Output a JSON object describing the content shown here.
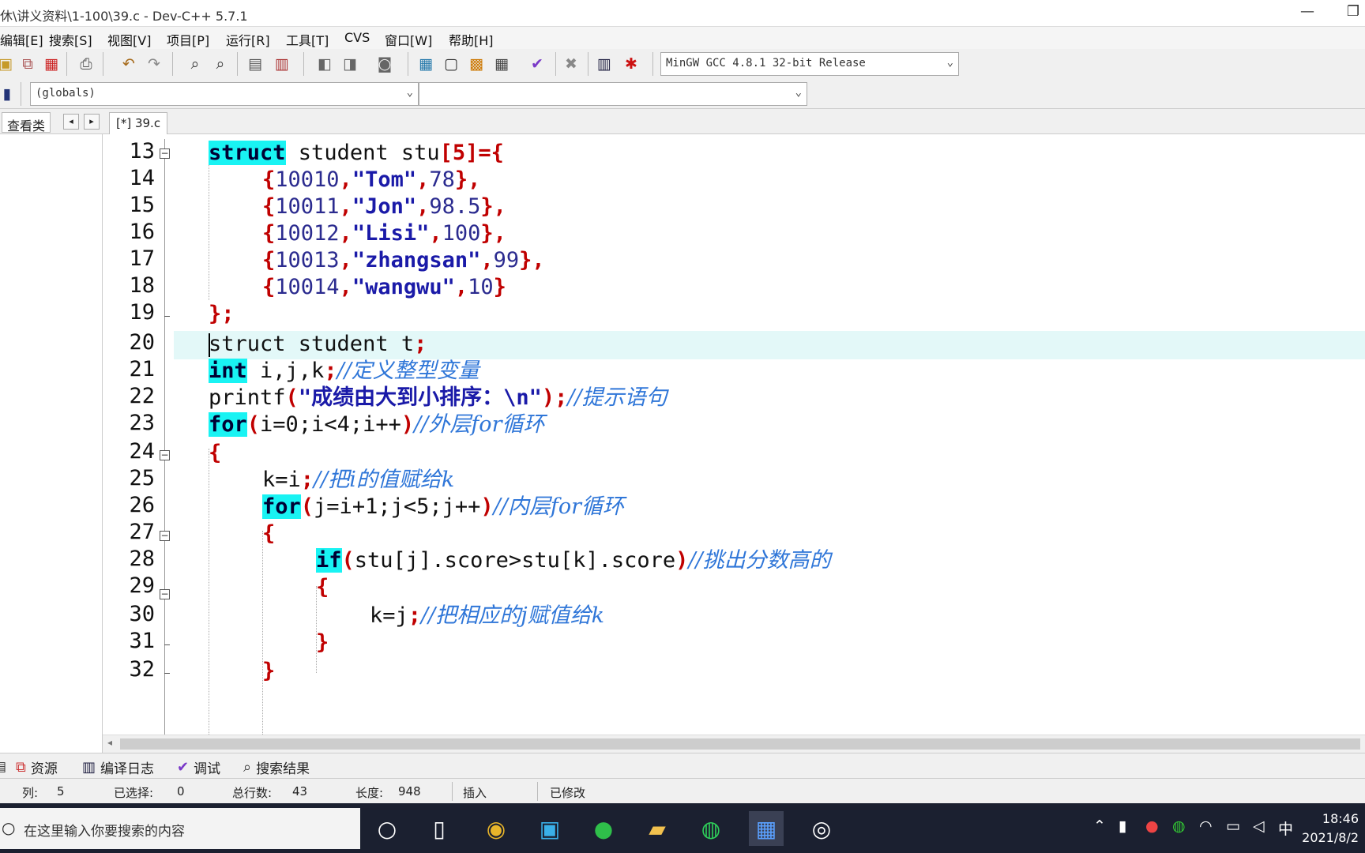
{
  "window": {
    "title": "休\\讲义资料\\1-100\\39.c - Dev-C++ 5.7.1",
    "minimize": "—",
    "restore": "❐"
  },
  "menu": {
    "items": [
      "编辑[E]",
      "搜索[S]",
      "视图[V]",
      "项目[P]",
      "运行[R]",
      "工具[T]",
      "CVS",
      "窗口[W]",
      "帮助[H]"
    ]
  },
  "toolbar": {
    "compiler": "MinGW GCC 4.8.1 32-bit Release",
    "scope": "(globals)",
    "member": ""
  },
  "left_panel": {
    "tab": "查看类",
    "prev": "◂",
    "next": "▸"
  },
  "editor": {
    "file_tab": "[*] 39.c",
    "line_numbers": [
      "13",
      "14",
      "15",
      "16",
      "17",
      "18",
      "19",
      "20",
      "21",
      "22",
      "23",
      "24",
      "25",
      "26",
      "27",
      "28",
      "29",
      "30",
      "31",
      "32"
    ],
    "code": {
      "l13": {
        "kw": "struct",
        "rest": " student stu",
        "sym": "[5]={"
      },
      "l14": {
        "open": "{",
        "n1": "10010",
        "c1": ",",
        "s": "\"Tom\"",
        "c2": ",",
        "n2": "78",
        "close": "},"
      },
      "l15": {
        "open": "{",
        "n1": "10011",
        "c1": ",",
        "s": "\"Jon\"",
        "c2": ",",
        "n2": "98.5",
        "close": "},"
      },
      "l16": {
        "open": "{",
        "n1": "10012",
        "c1": ",",
        "s": "\"Lisi\"",
        "c2": ",",
        "n2": "100",
        "close": "},"
      },
      "l17": {
        "open": "{",
        "n1": "10013",
        "c1": ",",
        "s": "\"zhangsan\"",
        "c2": ",",
        "n2": "99",
        "close": "},"
      },
      "l18": {
        "open": "{",
        "n1": "10014",
        "c1": ",",
        "s": "\"wangwu\"",
        "c2": ",",
        "n2": "10",
        "close": "}"
      },
      "l19": {
        "sym": "};"
      },
      "l20": {
        "text": "struct student t",
        "sym": ";"
      },
      "l21": {
        "kw": "int",
        "rest": " i,j,k",
        "sym": ";",
        "cmt": "//定义整型变量"
      },
      "l22": {
        "fn": "printf",
        "open": "(",
        "s": "\"成绩由大到小排序：\\n\"",
        "close": ");",
        "cmt": "//提示语句"
      },
      "l23": {
        "kw": "for",
        "open": "(",
        "mid": "i=0;i<4;i++",
        "close": ")",
        "cmt": "//外层for循环"
      },
      "l24": {
        "sym": "{"
      },
      "l25": {
        "text": "k=i",
        "sym": ";",
        "cmt": "//把i的值赋给k"
      },
      "l26": {
        "kw": "for",
        "open": "(",
        "mid": "j=i+1;j<5;j++",
        "close": ")",
        "cmt": "//内层for循环"
      },
      "l27": {
        "sym": "{"
      },
      "l28": {
        "kw": "if",
        "open": "(",
        "mid": "stu[j].score>stu[k].score",
        "close": ")",
        "cmt": "//挑出分数高的"
      },
      "l29": {
        "sym": "{"
      },
      "l30": {
        "text": "k=j",
        "sym": ";",
        "cmt": "//把相应的j赋值给k"
      },
      "l31": {
        "sym": "}"
      },
      "l32": {
        "sym": "}"
      }
    }
  },
  "bottom_tabs": [
    "资源",
    "编译日志",
    "调试",
    "搜索结果"
  ],
  "status": {
    "col_label": "列:",
    "col": "5",
    "sel_label": "已选择:",
    "sel": "0",
    "lines_label": "总行数:",
    "lines": "43",
    "len_label": "长度:",
    "len": "948",
    "mode": "插入",
    "modified": "已修改"
  },
  "taskbar": {
    "search_placeholder": "在这里输入你要搜索的内容",
    "ime": "中",
    "time": "18:46",
    "date": "2021/8/2"
  }
}
